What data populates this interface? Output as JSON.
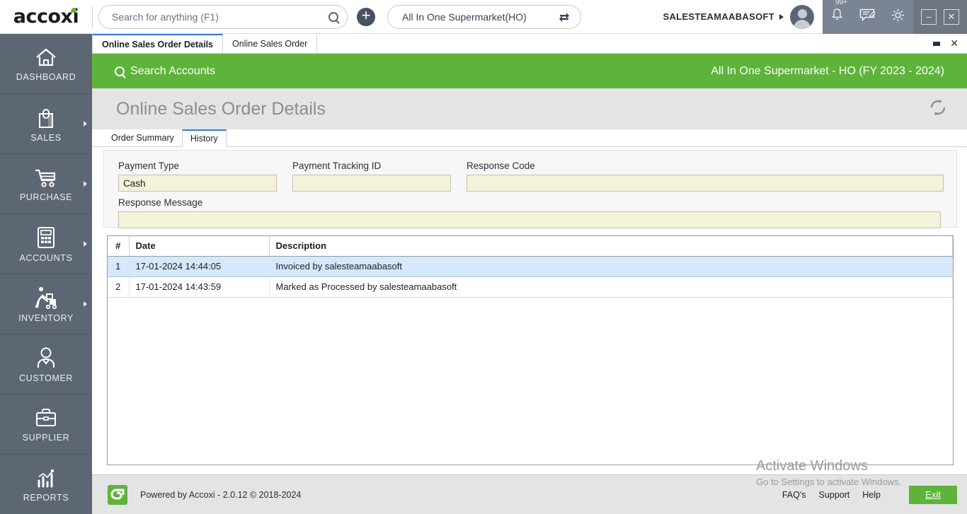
{
  "topbar": {
    "logo_text": "accoxi",
    "search": {
      "placeholder": "Search for anything (F1)",
      "value": ""
    },
    "add_button_label": "+",
    "branch": {
      "value": "All In One Supermarket(HO)"
    },
    "user_name": "SALESTEAMAABASOFT",
    "notification_badge": "99+",
    "minimize_label": "–",
    "close_label": "✕"
  },
  "sidebar": {
    "items": [
      {
        "label": "DASHBOARD",
        "icon": "home-icon",
        "has_arrow": false
      },
      {
        "label": "SALES",
        "icon": "shopping-bag-icon",
        "has_arrow": true
      },
      {
        "label": "PURCHASE",
        "icon": "shopping-cart-icon",
        "has_arrow": true
      },
      {
        "label": "ACCOUNTS",
        "icon": "calculator-icon",
        "has_arrow": true
      },
      {
        "label": "INVENTORY",
        "icon": "warehouse-worker-icon",
        "has_arrow": true
      },
      {
        "label": "CUSTOMER",
        "icon": "person-icon",
        "has_arrow": false
      },
      {
        "label": "SUPPLIER",
        "icon": "briefcase-icon",
        "has_arrow": false
      },
      {
        "label": "REPORTS",
        "icon": "bar-chart-icon",
        "has_arrow": false
      }
    ]
  },
  "window_tabs": {
    "tabs": [
      {
        "label": "Online Sales Order Details",
        "active": true
      },
      {
        "label": "Online Sales Order",
        "active": false
      }
    ],
    "close_label": "✕"
  },
  "green_bar": {
    "search_accounts_label": "Search Accounts",
    "company_fy": "All In One Supermarket - HO (FY 2023 - 2024)"
  },
  "page": {
    "title": "Online Sales Order Details",
    "refresh_icon": "refresh-icon"
  },
  "inner_tabs": [
    {
      "label": "Order Summary",
      "active": false
    },
    {
      "label": "History",
      "active": true
    }
  ],
  "form": {
    "payment_type": {
      "label": "Payment Type",
      "value": "Cash"
    },
    "payment_tracking_id": {
      "label": "Payment Tracking ID",
      "value": ""
    },
    "response_code": {
      "label": "Response Code",
      "value": ""
    },
    "response_message": {
      "label": "Response Message",
      "value": ""
    }
  },
  "history_table": {
    "columns": [
      "#",
      "Date",
      "Description"
    ],
    "rows": [
      {
        "num": "1",
        "date": "17-01-2024 14:44:05",
        "description": "Invoiced by salesteamaabasoft",
        "selected": true
      },
      {
        "num": "2",
        "date": "17-01-2024 14:43:59",
        "description": "Marked as Processed by salesteamaabasoft",
        "selected": false
      }
    ]
  },
  "footer": {
    "powered_by": "Powered by Accoxi - 2.0.12 © 2018-2024",
    "links": [
      "FAQ's",
      "Support",
      "Help"
    ],
    "exit_label": "Exit"
  },
  "watermark": {
    "line1": "Activate Windows",
    "line2": "Go to Settings to activate Windows."
  },
  "colors": {
    "brand_green": "#5eb33b",
    "sidebar": "#5d6673",
    "accent_blue": "#2f7fd6",
    "row_selected": "#d6e8fb",
    "field_yellow": "#f4f2da"
  }
}
